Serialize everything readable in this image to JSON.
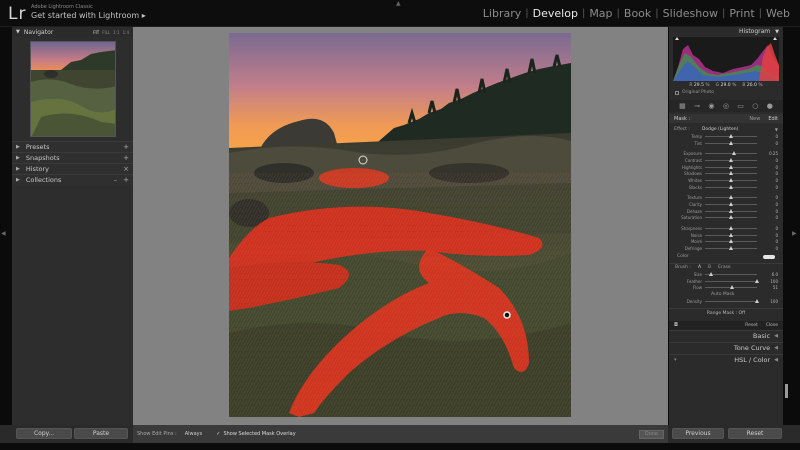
{
  "header": {
    "logo": "Lr",
    "app_subtitle": "Adobe Lightroom Classic",
    "catalog_title": "Get started with Lightroom",
    "modules": [
      "Library",
      "Develop",
      "Map",
      "Book",
      "Slideshow",
      "Print",
      "Web"
    ],
    "active_module": "Develop"
  },
  "left_panel": {
    "navigator": {
      "title": "Navigator",
      "zooms": [
        "FIT",
        "FILL",
        "1:1",
        "1:4"
      ],
      "active_zoom": "FIT"
    },
    "sections": [
      {
        "label": "Presets",
        "action": "+"
      },
      {
        "label": "Snapshots",
        "action": "+"
      },
      {
        "label": "History",
        "action": "×"
      },
      {
        "label": "Collections",
        "action": "+"
      }
    ],
    "copy_button": "Copy...",
    "paste_button": "Paste"
  },
  "right_panel": {
    "histogram": {
      "title": "Histogram",
      "values": {
        "r_label": "R",
        "r": "29.5",
        "g_label": "G",
        "g": "29.0",
        "b_label": "B",
        "b": "26.0",
        "unit": "%"
      },
      "original_photo": "Original Photo"
    },
    "mask": {
      "label": "Mask :",
      "new": "New",
      "edit": "Edit"
    },
    "effect": {
      "label": "Effect :",
      "value": "Dodge (Lighten)"
    },
    "sliders_group1": [
      {
        "label": "Temp",
        "value": "0",
        "pos": 0.5
      },
      {
        "label": "Tint",
        "value": "0",
        "pos": 0.5
      }
    ],
    "sliders_group2": [
      {
        "label": "Exposure",
        "value": "0.25",
        "pos": 0.56
      },
      {
        "label": "Contrast",
        "value": "0",
        "pos": 0.5
      },
      {
        "label": "Highlights",
        "value": "0",
        "pos": 0.5
      },
      {
        "label": "Shadows",
        "value": "0",
        "pos": 0.5
      },
      {
        "label": "Whites",
        "value": "0",
        "pos": 0.5
      },
      {
        "label": "Blacks",
        "value": "0",
        "pos": 0.5
      }
    ],
    "sliders_group3": [
      {
        "label": "Texture",
        "value": "0",
        "pos": 0.5
      },
      {
        "label": "Clarity",
        "value": "0",
        "pos": 0.5
      },
      {
        "label": "Dehaze",
        "value": "0",
        "pos": 0.5
      },
      {
        "label": "Saturation",
        "value": "0",
        "pos": 0.5
      }
    ],
    "sliders_group4": [
      {
        "label": "Sharpness",
        "value": "0",
        "pos": 0.5
      },
      {
        "label": "Noise",
        "value": "0",
        "pos": 0.5
      },
      {
        "label": "Moiré",
        "value": "0",
        "pos": 0.5
      },
      {
        "label": "Defringe",
        "value": "0",
        "pos": 0.5
      }
    ],
    "color_label": "Color",
    "brush": {
      "label": "Brush :",
      "a": "A",
      "b": "B",
      "erase": "Erase"
    },
    "brush_sliders": [
      {
        "label": "Size",
        "value": "6.0",
        "pos": 0.12
      },
      {
        "label": "Feather",
        "value": "100",
        "pos": 1.0
      },
      {
        "label": "Flow",
        "value": "51",
        "pos": 0.51
      }
    ],
    "auto_mask": "Auto Mask",
    "density": {
      "label": "Density",
      "value": "100",
      "pos": 1.0
    },
    "range_mask": "Range Mask : Off",
    "reset": "Reset",
    "close": "Close",
    "sections": [
      "Basic",
      "Tone Curve",
      "HSL / Color"
    ],
    "prev_button": "Previous",
    "reset_button": "Reset"
  },
  "toolbar": {
    "show_edit_pins_label": "Show Edit Pins :",
    "show_edit_pins_value": "Always",
    "overlay_check": "✓",
    "overlay_label": "Show Selected Mask Overlay",
    "done": "Done"
  },
  "colors": {
    "mask_overlay": "#e0301e",
    "sky_top": "#7a6a90",
    "sky_horizon": "#f0904a",
    "accent": "#d8d8d8"
  }
}
